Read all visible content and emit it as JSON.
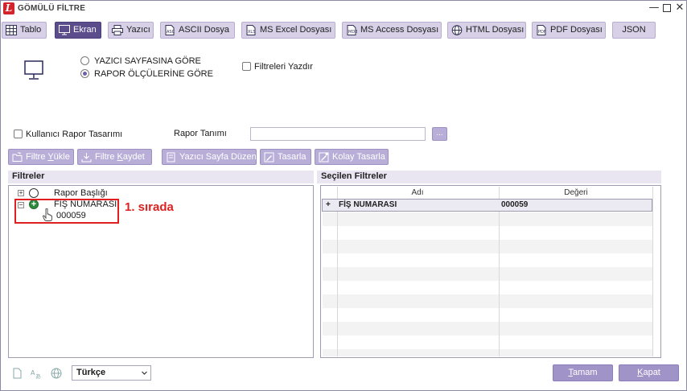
{
  "window": {
    "logo_letter": "L",
    "title": "GÖMÜLÜ FİLTRE",
    "min_glyph": "—",
    "close_glyph": "✕"
  },
  "toolbar": {
    "tabs": [
      {
        "label": "Tablo",
        "icon": "table-icon"
      },
      {
        "label": "Ekran",
        "icon": "monitor-icon",
        "active": true
      },
      {
        "label": "Yazıcı",
        "icon": "printer-icon"
      },
      {
        "label": "ASCII Dosya",
        "icon": "ascii-file-icon"
      },
      {
        "label": "MS Excel Dosyası",
        "icon": "excel-file-icon"
      },
      {
        "label": "MS Access Dosyası",
        "icon": "access-file-icon"
      },
      {
        "label": "HTML Dosyası",
        "icon": "globe-icon"
      },
      {
        "label": "PDF Dosyası",
        "icon": "pdf-file-icon"
      },
      {
        "label": "JSON"
      }
    ]
  },
  "output_options": {
    "icon": "monitor-icon",
    "radio_printer_page": "YAZICI SAYFASINA GÖRE",
    "radio_report_size": "RAPOR ÖLÇÜLERİNE GÖRE",
    "selected": "radio_report_size",
    "print_filters_label": "Filtreleri Yazdır",
    "print_filters_checked": false
  },
  "design": {
    "user_design_label": "Kullanıcı Rapor Tasarımı",
    "user_design_checked": false,
    "report_def_label": "Rapor Tanımı",
    "report_def_value": "",
    "browse_label": "..."
  },
  "actions": {
    "load_filter_pre": "Filtre ",
    "load_filter_u": "Y",
    "load_filter_post": "ükle",
    "save_filter_pre": "Filtre ",
    "save_filter_u": "K",
    "save_filter_post": "aydet",
    "printer_page_layout": "Yazıcı Sayfa Düzeni",
    "design": "Tasarla",
    "easy_design": "Kolay Tasarla"
  },
  "filters_panel": {
    "title": "Filtreler",
    "items": [
      {
        "label": "Rapor Başlığı",
        "expander": "+"
      },
      {
        "label": "FİŞ NUMARASI",
        "expander": "−",
        "value": "000059"
      }
    ],
    "annotation": "1. sırada"
  },
  "selected_filters": {
    "title": "Seçilen Filtreler",
    "columns": [
      "Adı",
      "Değeri"
    ],
    "rows": [
      {
        "marker": "+",
        "name": "FİŞ NUMARASI",
        "value": "000059"
      }
    ]
  },
  "footer": {
    "language": "Türkçe",
    "ok_u": "T",
    "ok_rest": "amam",
    "close_u": "K",
    "close_rest": "apat"
  }
}
